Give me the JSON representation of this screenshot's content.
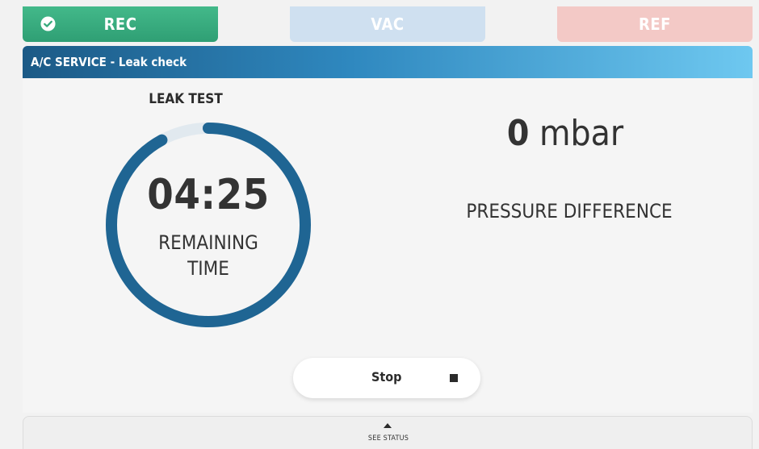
{
  "tabs": {
    "rec": "REC",
    "vac": "VAC",
    "ref": "REF",
    "rec_status": "completed"
  },
  "header": {
    "title": "A/C SERVICE - Leak check"
  },
  "leak_test": {
    "label": "LEAK TEST",
    "time": "04:25",
    "remaining_label": "REMAINING",
    "remaining_label_2": "TIME",
    "progress_fraction": 0.92
  },
  "pressure": {
    "value": "0",
    "unit": "mbar",
    "label": "PRESSURE DIFFERENCE"
  },
  "stop_button": {
    "label": "Stop",
    "icon": "stop-square-icon"
  },
  "status_bar": {
    "label": "SEE STATUS",
    "icon": "caret-up-icon"
  },
  "colors": {
    "rec_tab": "#3aae80",
    "vac_tab": "#cfe0f0",
    "ref_tab": "#f3c9c6",
    "header_start": "#1c5a86",
    "header_end": "#6ec8f0",
    "gauge_progress": "#1f6593",
    "gauge_track": "#e1e9ef"
  }
}
